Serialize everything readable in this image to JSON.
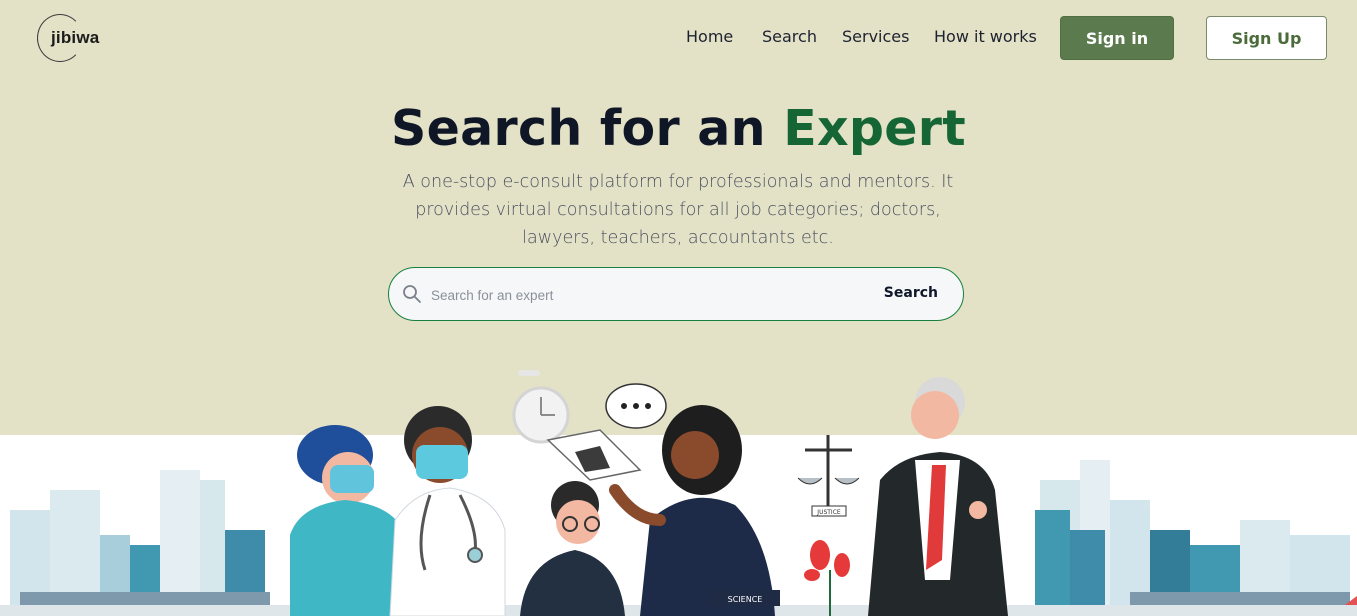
{
  "brand": {
    "name": "jibiwa"
  },
  "nav": {
    "links": [
      "Home",
      "Search",
      "Services",
      "How it works"
    ],
    "sign_in": "Sign in",
    "sign_up": "Sign Up"
  },
  "hero": {
    "title_main": "Search for an",
    "title_accent": "Expert",
    "description": "A one-stop e-consult platform for professionals and mentors. It provides virtual consultations for all job categories; doctors, lawyers, teachers, accountants etc.",
    "search": {
      "placeholder": "Search for an expert",
      "button": "Search"
    }
  },
  "illustration": {
    "book_label": "SCIENCE",
    "scales_label": "JUSTICE"
  },
  "colors": {
    "background": "#e3e1c6",
    "accent": "#166534",
    "primary_button": "#5b7a4d"
  }
}
